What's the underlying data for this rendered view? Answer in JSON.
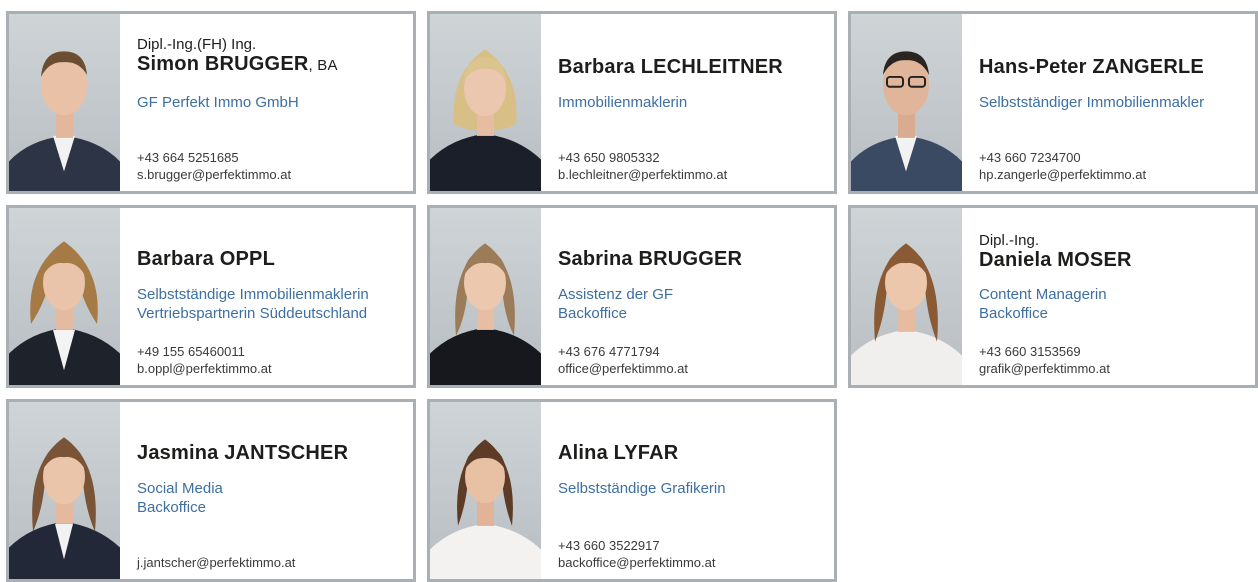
{
  "cards": [
    {
      "prefix": "Dipl.-Ing.(FH) Ing.",
      "name": "Simon BRUGGER",
      "suffix": ", BA",
      "roles": [
        "GF Perfekt Immo GmbH"
      ],
      "phone": "+43 664 5251685",
      "email": "s.brugger@perfektimmo.at"
    },
    {
      "prefix": "",
      "name": "Barbara LECHLEITNER",
      "suffix": "",
      "roles": [
        "Immobilienmaklerin"
      ],
      "phone": "+43 650 9805332",
      "email": "b.lechleitner@perfektimmo.at"
    },
    {
      "prefix": "",
      "name": "Hans-Peter ZANGERLE",
      "suffix": "",
      "roles": [
        "Selbstständiger Immobilienmakler"
      ],
      "phone": "+43 660 7234700",
      "email": "hp.zangerle@perfektimmo.at"
    },
    {
      "prefix": "",
      "name": "Barbara OPPL",
      "suffix": "",
      "roles": [
        "Selbstständige Immobilienmaklerin",
        "Vertriebspartnerin Süddeutschland"
      ],
      "phone": "+49 155 65460011",
      "email": "b.oppl@perfektimmo.at"
    },
    {
      "prefix": "",
      "name": "Sabrina BRUGGER",
      "suffix": "",
      "roles": [
        "Assistenz der GF",
        "Backoffice"
      ],
      "phone": "+43 676 4771794",
      "email": "office@perfektimmo.at"
    },
    {
      "prefix": "Dipl.-Ing.",
      "name": "Daniela MOSER",
      "suffix": "",
      "roles": [
        "Content Managerin",
        "Backoffice"
      ],
      "phone": "+43 660 3153569",
      "email": "grafik@perfektimmo.at"
    },
    {
      "prefix": "",
      "name": "Jasmina JANTSCHER",
      "suffix": "",
      "roles": [
        "Social Media",
        "Backoffice"
      ],
      "phone": "",
      "email": "j.jantscher@perfektimmo.at"
    },
    {
      "prefix": "",
      "name": "Alina LYFAR",
      "suffix": "",
      "roles": [
        "Selbstständige Grafikerin"
      ],
      "phone": "+43 660 3522917",
      "email": "backoffice@perfektimmo.at"
    }
  ],
  "colors": {
    "name": "#1d1d1b",
    "role": "#3d6fa0",
    "border": "#a9afb3",
    "photo_bg": "#c4c9cc"
  },
  "icons": {
    "portrait": "person-portrait-icon"
  }
}
